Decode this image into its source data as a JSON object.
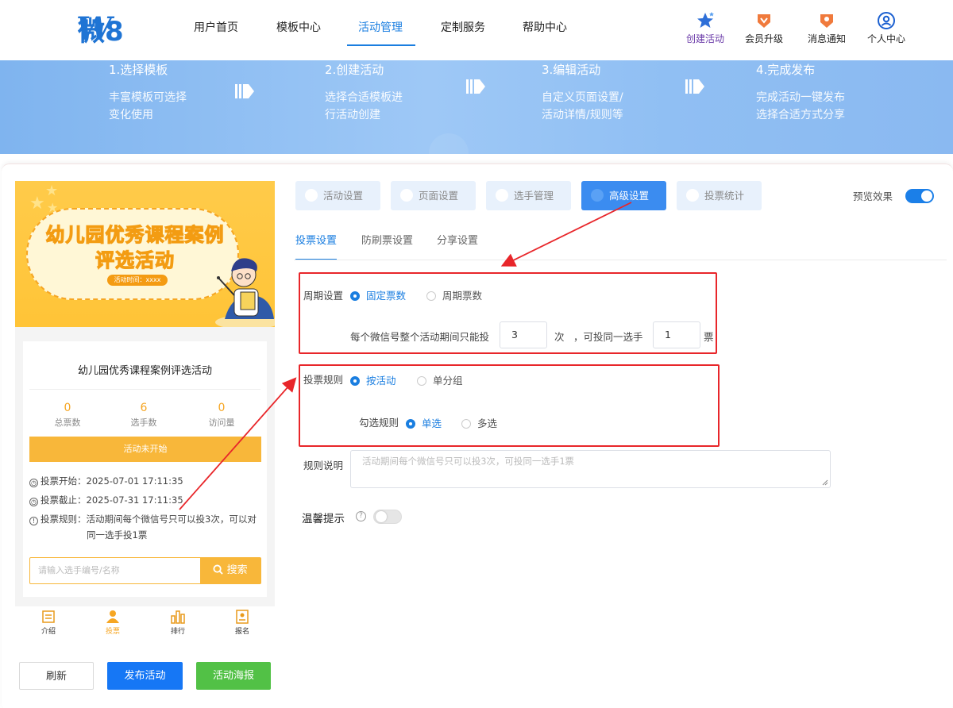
{
  "brand": {
    "logo_mark": "W",
    "logo_text": "微8"
  },
  "nav": {
    "items": [
      {
        "label": "用户首页"
      },
      {
        "label": "模板中心"
      },
      {
        "label": "活动管理",
        "active": true
      },
      {
        "label": "定制服务"
      },
      {
        "label": "帮助中心"
      }
    ],
    "tools": [
      {
        "label": "创建活动",
        "icon": "star-icon"
      },
      {
        "label": "会员升级",
        "icon": "vip-icon"
      },
      {
        "label": "消息通知",
        "icon": "bell-icon"
      },
      {
        "label": "个人中心",
        "icon": "user-icon"
      }
    ]
  },
  "steps": [
    {
      "title": "1.选择模板",
      "line1": "丰富模板可选择",
      "line2": "变化使用"
    },
    {
      "title": "2.创建活动",
      "line1": "选择合适模板进",
      "line2": "行活动创建"
    },
    {
      "title": "3.编辑活动",
      "line1": "自定义页面设置/",
      "line2": "活动详情/规则等"
    },
    {
      "title": "4.完成发布",
      "line1": "完成活动一键发布",
      "line2": "选择合适方式分享"
    }
  ],
  "preview": {
    "poster_title_line1": "幼儿园优秀课程案例",
    "poster_title_line2": "评选活动",
    "poster_time": "活动时间：xxxx",
    "title": "幼儿园优秀课程案例评选活动",
    "stats": [
      {
        "value": "0",
        "label": "总票数"
      },
      {
        "value": "6",
        "label": "选手数"
      },
      {
        "value": "0",
        "label": "访问量"
      }
    ],
    "status": "活动未开始",
    "vote_start": "投票开始：2025-07-01 17:11:35",
    "vote_end": "投票截止：2025-07-31 17:11:35",
    "rule_line1": "投票规则：活动期间每个微信号只可以投3次，可以对",
    "rule_line2": "同一选手投1票",
    "search_placeholder": "请输入选手编号/名称",
    "search_button": "搜索",
    "tabs": [
      {
        "label": "介绍",
        "icon": "intro-icon"
      },
      {
        "label": "投票",
        "icon": "vote-icon",
        "active": true
      },
      {
        "label": "排行",
        "icon": "rank-icon"
      },
      {
        "label": "报名",
        "icon": "signup-icon"
      }
    ]
  },
  "actions": {
    "refresh": "刷新",
    "publish": "发布活动",
    "poster": "活动海报"
  },
  "settings": {
    "tabs": [
      {
        "label": "活动设置"
      },
      {
        "label": "页面设置"
      },
      {
        "label": "选手管理"
      },
      {
        "label": "高级设置",
        "active": true
      },
      {
        "label": "投票统计"
      }
    ],
    "preview_label": "预览效果",
    "preview_on": true,
    "subtabs": [
      {
        "label": "投票设置",
        "active": true
      },
      {
        "label": "防刷票设置"
      },
      {
        "label": "分享设置"
      }
    ],
    "cycle": {
      "label": "周期设置",
      "options": [
        {
          "label": "固定票数",
          "selected": true
        },
        {
          "label": "周期票数",
          "selected": false
        }
      ],
      "text1": "每个微信号整个活动期间只能投",
      "votes": "3",
      "text2": "次",
      "text3": "，可投同一选手",
      "same": "1",
      "text4": "票"
    },
    "rule": {
      "label": "投票规则",
      "options": [
        {
          "label": "按活动",
          "selected": true
        },
        {
          "label": "单分组",
          "selected": false
        }
      ],
      "check_label": "勾选规则",
      "check_options": [
        {
          "label": "单选",
          "selected": true
        },
        {
          "label": "多选",
          "selected": false
        }
      ]
    },
    "desc": {
      "label": "规则说明",
      "placeholder": "活动期间每个微信号只可以投3次，可投同一选手1票"
    },
    "tip": {
      "label": "温馨提示",
      "help": "?",
      "on": false
    }
  },
  "colors": {
    "primary": "#1a7ee0",
    "accent": "#f8b73a",
    "green": "#52c146",
    "annotation": "#e8262a"
  }
}
